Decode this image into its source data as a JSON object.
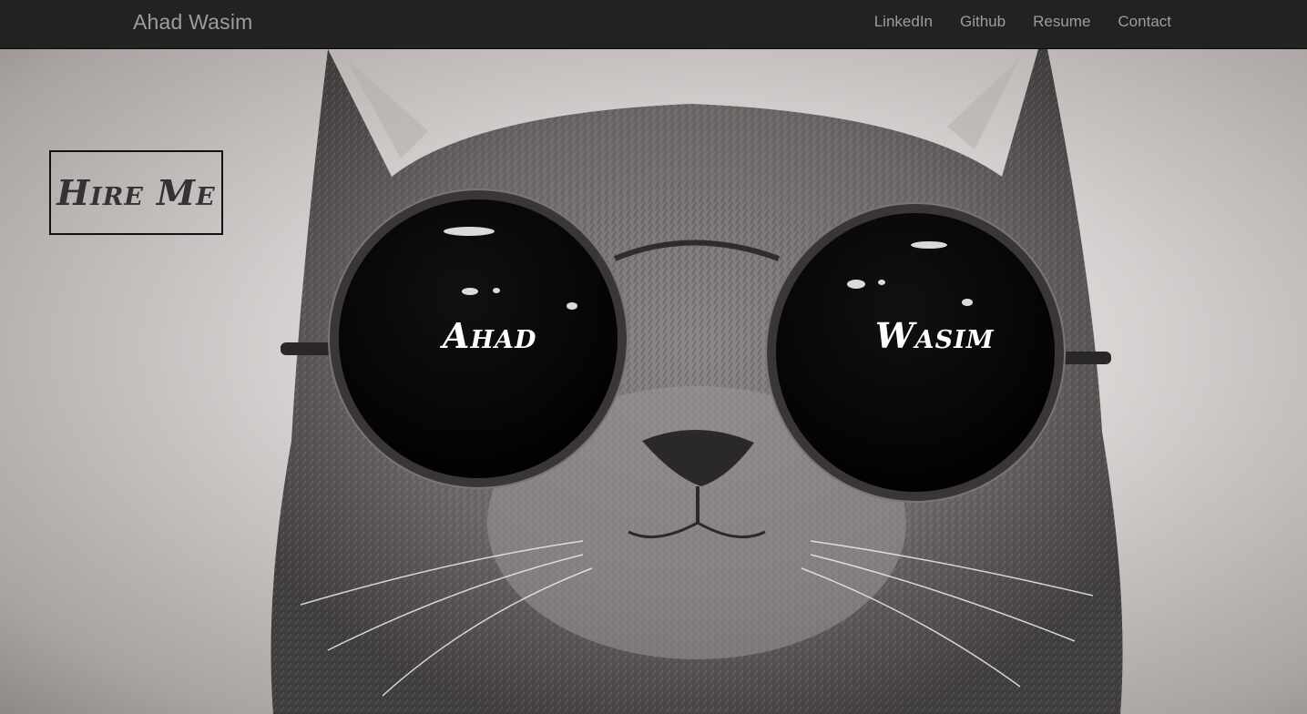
{
  "navbar": {
    "brand": "Ahad Wasim",
    "links": [
      {
        "label": "LinkedIn"
      },
      {
        "label": "Github"
      },
      {
        "label": "Resume"
      },
      {
        "label": "Contact"
      }
    ]
  },
  "hero": {
    "image_subject": "cat wearing round sunglasses",
    "hire_button": "Hire Me",
    "left_lens_text": "Ahad",
    "right_lens_text": "Wasim"
  },
  "colors": {
    "navbar_bg": "#222222",
    "nav_text": "#9d9d9d",
    "lens_text": "#ffffff"
  }
}
